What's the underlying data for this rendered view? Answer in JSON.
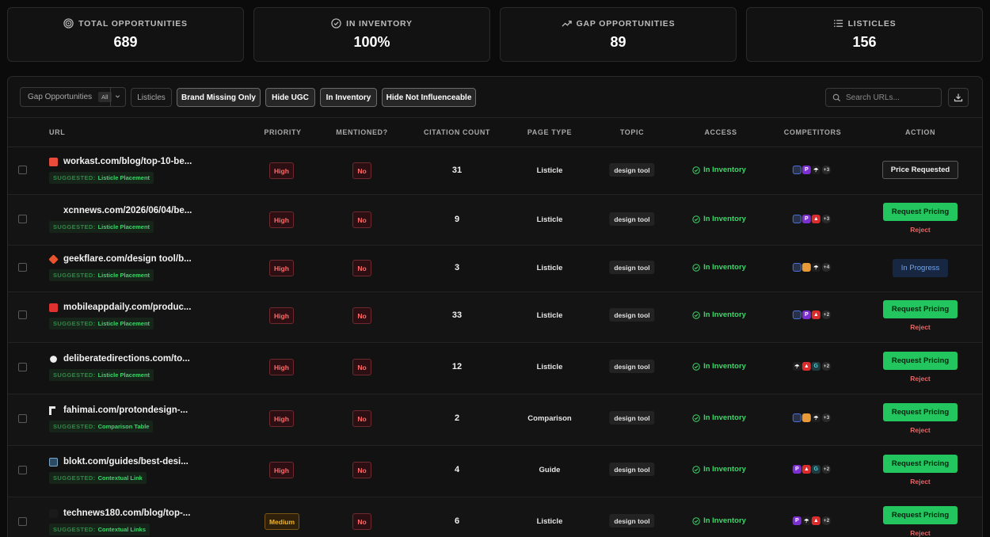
{
  "stats": [
    {
      "label": "TOTAL OPPORTUNITIES",
      "value": "689",
      "icon": "target-icon"
    },
    {
      "label": "IN INVENTORY",
      "value": "100%",
      "icon": "check-circle-icon"
    },
    {
      "label": "GAP OPPORTUNITIES",
      "value": "89",
      "icon": "trending-up-icon"
    },
    {
      "label": "LISTICLES",
      "value": "156",
      "icon": "list-icon"
    }
  ],
  "toolbar": {
    "dropdown_label": "Gap Opportunities",
    "dropdown_tag": "All",
    "listicles": "Listicles",
    "brand_missing": "Brand Missing Only",
    "hide_ugc": "Hide UGC",
    "in_inventory": "In Inventory",
    "hide_not_influenceable": "Hide Not Influenceable",
    "search_placeholder": "Search URLs..."
  },
  "columns": {
    "url": "URL",
    "priority": "PRIORITY",
    "mentioned": "MENTIONED?",
    "citation": "CITATION COUNT",
    "page_type": "PAGE TYPE",
    "topic": "TOPIC",
    "access": "ACCESS",
    "competitors": "COMPETITORS",
    "action": "ACTION"
  },
  "suggested_label": "SUGGESTED:",
  "rows": [
    {
      "url": "workast.com/blog/top-10-be...",
      "suggestion": "Listicle Placement",
      "priority": "High",
      "mentioned": "No",
      "count": "31",
      "page_type": "Listicle",
      "topic": "design tool",
      "access": "In Inventory",
      "more": "+3",
      "action": "Price Requested",
      "reject": ""
    },
    {
      "url": "xcnnews.com/2026/06/04/be...",
      "suggestion": "Listicle Placement",
      "priority": "High",
      "mentioned": "No",
      "count": "9",
      "page_type": "Listicle",
      "topic": "design tool",
      "access": "In Inventory",
      "more": "+3",
      "action": "Request Pricing",
      "reject": "Reject"
    },
    {
      "url": "geekflare.com/design tool/b...",
      "suggestion": "Listicle Placement",
      "priority": "High",
      "mentioned": "No",
      "count": "3",
      "page_type": "Listicle",
      "topic": "design tool",
      "access": "In Inventory",
      "more": "+4",
      "action": "In Progress",
      "reject": ""
    },
    {
      "url": "mobileappdaily.com/produc...",
      "suggestion": "Listicle Placement",
      "priority": "High",
      "mentioned": "No",
      "count": "33",
      "page_type": "Listicle",
      "topic": "design tool",
      "access": "In Inventory",
      "more": "+2",
      "action": "Request Pricing",
      "reject": "Reject"
    },
    {
      "url": "deliberatedirections.com/to...",
      "suggestion": "Listicle Placement",
      "priority": "High",
      "mentioned": "No",
      "count": "12",
      "page_type": "Listicle",
      "topic": "design tool",
      "access": "In Inventory",
      "more": "+2",
      "action": "Request Pricing",
      "reject": "Reject"
    },
    {
      "url": "fahimai.com/protondesign-...",
      "suggestion": "Comparison Table",
      "priority": "High",
      "mentioned": "No",
      "count": "2",
      "page_type": "Comparison",
      "topic": "design tool",
      "access": "In Inventory",
      "more": "+3",
      "action": "Request Pricing",
      "reject": "Reject"
    },
    {
      "url": "blokt.com/guides/best-desi...",
      "suggestion": "Contextual Link",
      "priority": "High",
      "mentioned": "No",
      "count": "4",
      "page_type": "Guide",
      "topic": "design tool",
      "access": "In Inventory",
      "more": "+2",
      "action": "Request Pricing",
      "reject": "Reject"
    },
    {
      "url": "technews180.com/blog/top-...",
      "suggestion": "Contextual Links",
      "priority": "Medium",
      "mentioned": "No",
      "count": "6",
      "page_type": "Listicle",
      "topic": "design tool",
      "access": "In Inventory",
      "more": "+2",
      "action": "Request Pricing",
      "reject": "Reject"
    }
  ]
}
